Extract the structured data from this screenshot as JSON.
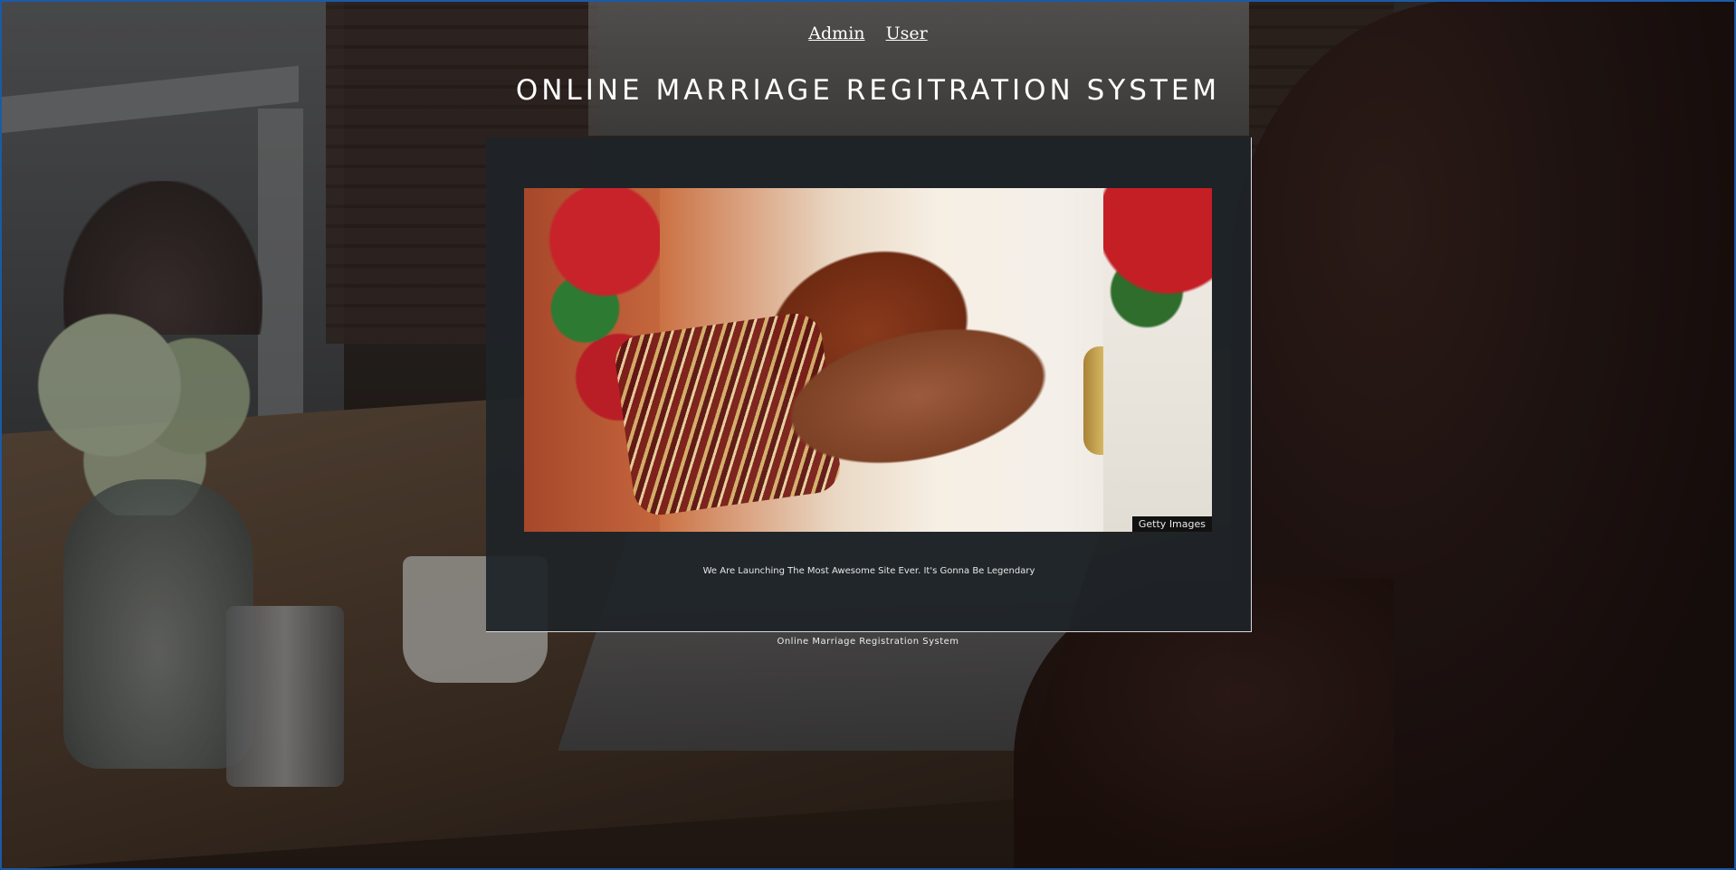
{
  "nav": {
    "links": [
      {
        "label": "Admin"
      },
      {
        "label": "User"
      }
    ]
  },
  "header": {
    "title": "ONLINE MARRIAGE REGITRATION SYSTEM"
  },
  "main": {
    "hero": {
      "credit": "Getty Images"
    },
    "tagline": "We Are Launching The Most Awesome Site Ever. It's Gonna Be Legendary"
  },
  "footer": {
    "text": "Online Marriage Registration System"
  },
  "colors": {
    "title": "#ffffff",
    "panel": "#1e2428",
    "accent_border": "#1c5aa6"
  }
}
